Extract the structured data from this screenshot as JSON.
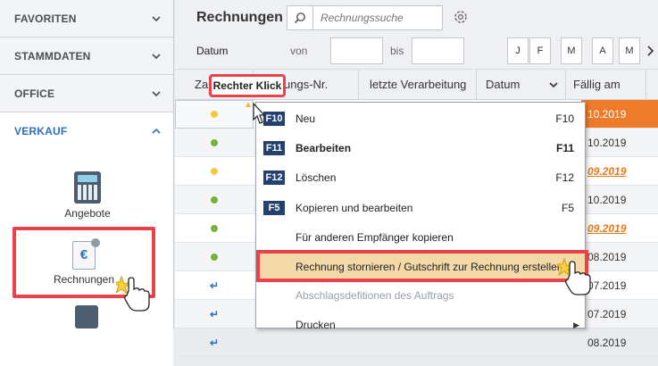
{
  "sidebar": {
    "sections": [
      {
        "label": "FAVORITEN"
      },
      {
        "label": "STAMMDATEN"
      },
      {
        "label": "OFFICE"
      },
      {
        "label": "VERKAUF"
      }
    ],
    "tiles": {
      "angebote": "Angebote",
      "rechnungen": "Rechnungen"
    }
  },
  "toolbar": {
    "title": "Rechnungen",
    "search_placeholder": "Rechnungssuche",
    "datum_label": "Datum",
    "von_label": "von",
    "bis_label": "bis",
    "months": [
      "J",
      "F",
      "M",
      "A",
      "M"
    ]
  },
  "table": {
    "columns": {
      "col1": "Za",
      "col2": "ungs-Nr.",
      "col3": "letzte Verarbeitung",
      "col4": "Datum",
      "col5": "Fällig am"
    },
    "rows": [
      {
        "status": "yellow",
        "due": "10.2019"
      },
      {
        "status": "green",
        "due": "10.2019"
      },
      {
        "status": "yellow",
        "due": "09.2019"
      },
      {
        "status": "green",
        "due": "10.2019"
      },
      {
        "status": "green",
        "due": "09.2019"
      },
      {
        "status": "green",
        "due": "08.2019"
      },
      {
        "status": "arrow",
        "due": "07.2019"
      },
      {
        "status": "arrow",
        "due": "07.2019"
      },
      {
        "status": "arrow",
        "due": "08.2019"
      }
    ]
  },
  "callout": "Rechter Klick",
  "context_menu": {
    "items": [
      {
        "key": "F10",
        "label": "Neu",
        "shortcut": "F10"
      },
      {
        "key": "F11",
        "label": "Bearbeiten",
        "shortcut": "F11"
      },
      {
        "key": "F12",
        "label": "Löschen",
        "shortcut": "F12"
      },
      {
        "key": "F5",
        "label": "Kopieren und bearbeiten",
        "shortcut": "F5"
      },
      {
        "label": "Für anderen Empfänger kopieren"
      },
      {
        "label": "Rechnung stornieren / Gutschrift zur Rechnung erstellen"
      },
      {
        "label": "Abschlagsdefitionen des Auftrags"
      },
      {
        "label": "Drucken"
      }
    ]
  },
  "colors": {
    "accent_blue": "#2e6fbf",
    "highlight_red": "#e8434a",
    "orange": "#ee7b2c",
    "menu_key_bg": "#23406e"
  }
}
